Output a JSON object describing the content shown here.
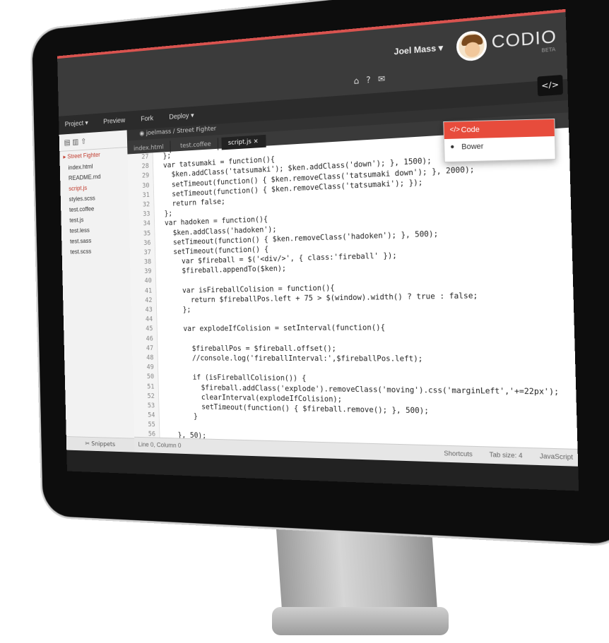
{
  "header": {
    "logo": "CODIO",
    "beta": "BETA",
    "user": "Joel Mass"
  },
  "menu": [
    "Project",
    "Preview",
    "Fork",
    "Deploy"
  ],
  "breadcrumb": "joelmass / Street Fighter",
  "tabs": [
    "index.html",
    "test.coffee",
    "script.js"
  ],
  "file_tree": {
    "folder": "Street Fighter",
    "files": [
      "index.html",
      "README.md",
      "script.js",
      "styles.scss",
      "test.coffee",
      "test.js",
      "test.less",
      "test.sass",
      "test.scss"
    ]
  },
  "snippets_label": "Snippets",
  "status": {
    "position": "Line 0, Column 0",
    "shortcuts": "Shortcuts",
    "tab_size": "Tab size: 4",
    "language": "JavaScript"
  },
  "dropdown": {
    "options": [
      "Code",
      "Bower"
    ]
  },
  "code": {
    "line_numbers": [
      "27",
      "28",
      "29",
      "30",
      "31",
      "32",
      "33",
      "34",
      "35",
      "36",
      "37",
      "38",
      "39",
      "40",
      "41",
      "42",
      "43",
      "44",
      "45",
      "46",
      "47",
      "48",
      "49",
      "50",
      "51",
      "52",
      "53",
      "54",
      "55",
      "56"
    ],
    "lines": [
      "  };",
      "  var tatsumaki = function(){",
      "    $ken.addClass('tatsumaki'); $ken.addClass('down'); }, 1500);",
      "    setTimeout(function() { $ken.removeClass('tatsumaki down'); }, 2000);",
      "    setTimeout(function() { $ken.removeClass('tatsumaki'); });",
      "    return false;",
      "  };",
      "  var hadoken = function(){",
      "    $ken.addClass('hadoken');",
      "    setTimeout(function() { $ken.removeClass('hadoken'); }, 500);",
      "    setTimeout(function() {",
      "      var $fireball = $('<div/>', { class:'fireball' });",
      "      $fireball.appendTo($ken);",
      "",
      "      var isFireballColision = function(){",
      "        return $fireballPos.left + 75 > $(window).width() ? true : false;",
      "      };",
      "",
      "      var explodeIfColision = setInterval(function(){",
      "",
      "        $fireballPos = $fireball.offset();",
      "        //console.log('fireballInterval:',$fireballPos.left);",
      "",
      "        if (isFireballColision()) {",
      "          $fireball.addClass('explode').removeClass('moving').css('marginLeft','+=22px');",
      "          clearInterval(explodeIfColision);",
      "          setTimeout(function() { $fireball.remove(); }, 500);",
      "        }",
      "",
      "    }, 50);"
    ]
  }
}
